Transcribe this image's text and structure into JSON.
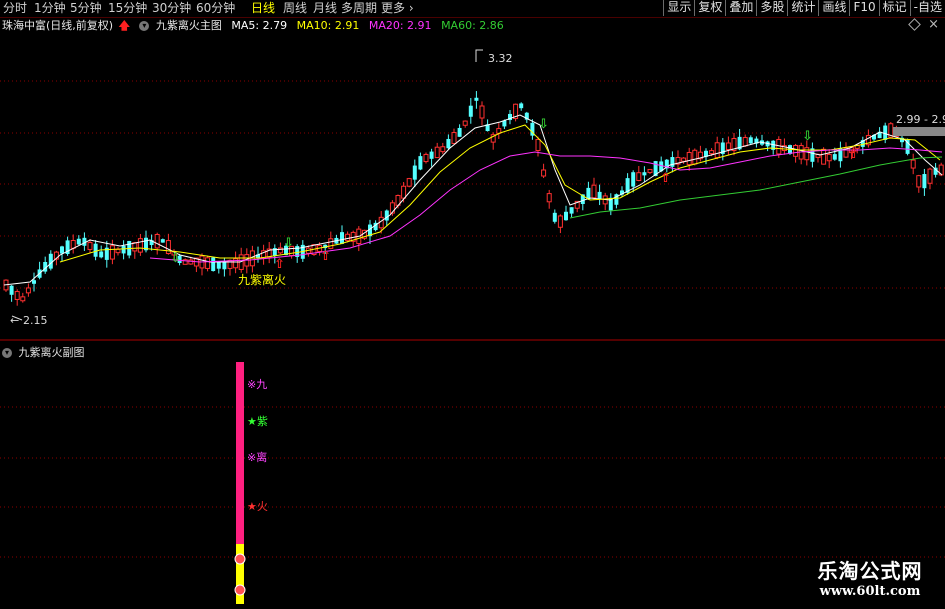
{
  "toolbar": {
    "periods": [
      "分时",
      "1分钟",
      "5分钟",
      "15分钟",
      "30分钟",
      "60分钟",
      "日线",
      "周线",
      "月线",
      "多周期",
      "更多"
    ],
    "active_period": "日线",
    "more_caret": "›",
    "buttons": [
      "显示",
      "复权",
      "叠加",
      "多股",
      "统计",
      "画线",
      "F10",
      "标记",
      "-自选"
    ]
  },
  "info": {
    "stock": "珠海中富(日线,前复权)",
    "indicator": "九紫离火主图",
    "ma5": "MA5: 2.79",
    "ma10": "MA10: 2.91",
    "ma20": "MA20: 2.91",
    "ma60": "MA60: 2.86"
  },
  "main_chart": {
    "high_label": "3.32",
    "low_label": "2.15",
    "range_label": "2.99 - 2.95",
    "overlay_label": "九紫离火",
    "colors": {
      "up": "#ff3030",
      "down": "#54ffff",
      "ma5": "#ffffff",
      "ma10": "#ffff00",
      "ma20": "#ff33ff",
      "ma60": "#33cc33"
    }
  },
  "sub_chart": {
    "title": "九紫离火副图",
    "labels": [
      {
        "symbol": "※",
        "text": "九",
        "color": "#ff44ff"
      },
      {
        "symbol": "★",
        "text": "紫",
        "color": "#33ff33"
      },
      {
        "symbol": "※",
        "text": "离",
        "color": "#ff44ff"
      },
      {
        "symbol": "★",
        "text": "火",
        "color": "#ff3030"
      }
    ],
    "bar_color": "#ff2080",
    "bar_bottom_color": "#ffff00"
  },
  "watermark": {
    "line1": "乐淘公式网",
    "line2": "www.60lt.com"
  }
}
